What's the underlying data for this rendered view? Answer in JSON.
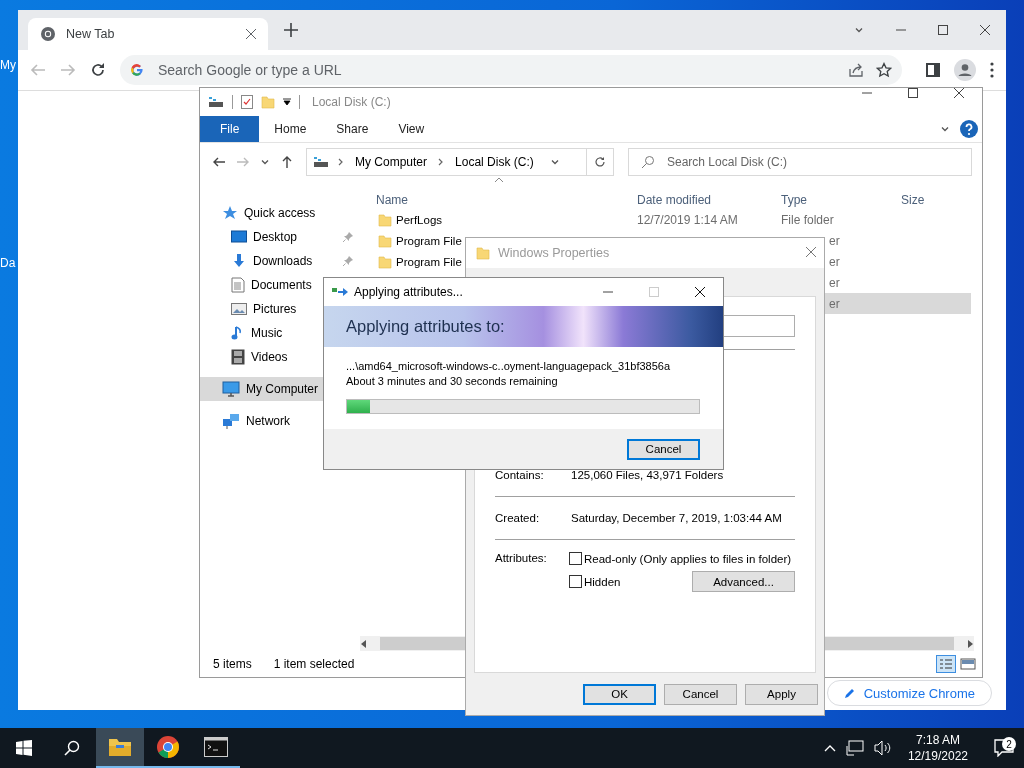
{
  "desktop": {
    "icons": [
      {
        "label": "My"
      },
      {
        "label": "Da"
      }
    ]
  },
  "browser": {
    "tabs": [
      {
        "title": "New Tab",
        "selected": true
      }
    ],
    "omnibox": {
      "placeholder": "Search Google or type a URL"
    },
    "customize_button": "Customize Chrome"
  },
  "explorer": {
    "title": "Local Disk (C:)",
    "ribbon_tabs": [
      {
        "label": "File",
        "selected": true
      },
      {
        "label": "Home",
        "selected": false
      },
      {
        "label": "Share",
        "selected": false
      },
      {
        "label": "View",
        "selected": false
      }
    ],
    "breadcrumbs": [
      "My Computer",
      "Local Disk (C:)"
    ],
    "search": {
      "placeholder": "Search Local Disk (C:)"
    },
    "sidebar": [
      {
        "label": "Quick access",
        "kind": "star",
        "selected": false,
        "children": [
          {
            "label": "Desktop",
            "kind": "desktop",
            "pinned": true,
            "selected": false
          },
          {
            "label": "Downloads",
            "kind": "download",
            "pinned": true,
            "selected": false
          },
          {
            "label": "Documents",
            "kind": "document",
            "selected": false
          },
          {
            "label": "Pictures",
            "kind": "pictures",
            "selected": false
          },
          {
            "label": "Music",
            "kind": "music",
            "selected": false
          },
          {
            "label": "Videos",
            "kind": "video",
            "selected": false
          }
        ]
      },
      {
        "label": "My Computer",
        "kind": "computer",
        "selected": true
      },
      {
        "label": "Network",
        "kind": "network",
        "selected": false
      }
    ],
    "columns": [
      "Name",
      "Date modified",
      "Type",
      "Size"
    ],
    "rows": [
      {
        "name": "PerfLogs",
        "date": "12/7/2019 1:14 AM",
        "type": "File folder",
        "selected": false
      },
      {
        "name": "Program File",
        "type": "er",
        "selected": false
      },
      {
        "name": "Program File",
        "type": "er",
        "selected": false
      },
      {
        "type": "er",
        "selected": false
      },
      {
        "type": "er",
        "selected": true
      }
    ],
    "status": [
      "5 items",
      "1 item selected"
    ]
  },
  "properties": {
    "title": "Windows Properties",
    "fields": [
      {
        "label": "Contains:",
        "value": "125,060 Files, 43,971 Folders"
      },
      {
        "label": "Created:",
        "value": "Saturday, December 7, 2019, 1:03:44 AM"
      }
    ],
    "attributes_label": "Attributes:",
    "checkboxes": [
      {
        "label": "Read-only (Only applies to files in folder)",
        "checked": false
      },
      {
        "label": "Hidden",
        "checked": false
      }
    ],
    "advanced_button": "Advanced...",
    "buttons": [
      "OK",
      "Cancel",
      "Apply"
    ]
  },
  "progress_dialog": {
    "title": "Applying attributes...",
    "heading": "Applying attributes to:",
    "path": "...\\amd64_microsoft-windows-c..oyment-languagepack_31bf3856a",
    "time_remaining": "About 3 minutes and 30 seconds remaining",
    "level": 0.065,
    "button": "Cancel"
  },
  "taskbar": {
    "apps": [
      {
        "kind": "explorer",
        "active": true
      },
      {
        "kind": "chrome",
        "active": false
      },
      {
        "kind": "terminal",
        "active": false
      }
    ],
    "time": "7:18 AM",
    "date": "12/19/2022",
    "notifications": "2"
  }
}
